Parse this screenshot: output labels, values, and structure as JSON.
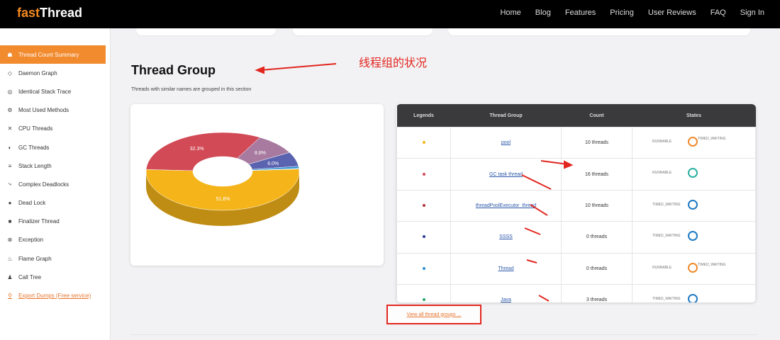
{
  "app": {
    "logo_prefix": "fast",
    "logo_suffix": "Thread"
  },
  "nav": [
    "Home",
    "Blog",
    "Features",
    "Pricing",
    "User Reviews",
    "FAQ",
    "Sign In"
  ],
  "sidebar": {
    "items": [
      {
        "label": "Thread Count Summary",
        "icon": "summary-icon",
        "glyph": "☗"
      },
      {
        "label": "Daemon Graph",
        "icon": "daemon-icon",
        "glyph": "◇"
      },
      {
        "label": "Identical Stack Trace",
        "icon": "stack-icon",
        "glyph": "◎"
      },
      {
        "label": "Most Used Methods",
        "icon": "methods-icon",
        "glyph": "⚙"
      },
      {
        "label": "CPU Threads",
        "icon": "cpu-icon",
        "glyph": "✕"
      },
      {
        "label": "GC Threads",
        "icon": "gc-icon",
        "glyph": "◐"
      },
      {
        "label": "Stack Length",
        "icon": "length-icon",
        "glyph": "≡"
      },
      {
        "label": "Complex Deadlocks",
        "icon": "deadlock-icon",
        "glyph": "⤷"
      },
      {
        "label": "Dead Lock",
        "icon": "lock-icon",
        "glyph": "●"
      },
      {
        "label": "Finalizer Thread",
        "icon": "finalizer-icon",
        "glyph": "■"
      },
      {
        "label": "Exception",
        "icon": "exception-icon",
        "glyph": "⊗"
      },
      {
        "label": "Flame Graph",
        "icon": "flame-icon",
        "glyph": "♨"
      },
      {
        "label": "Call Tree",
        "icon": "tree-icon",
        "glyph": "♟"
      },
      {
        "label": "Export Dumps (Free service)",
        "icon": "export-icon",
        "glyph": "⚲"
      }
    ]
  },
  "main": {
    "title": "Thread Group",
    "description": "Threads with similar names are grouped in this section",
    "annotation": "线程组的状况",
    "more_button": "View all thread groups ..."
  },
  "chart_data": {
    "type": "pie",
    "title": "",
    "categories": [
      "GC task thread",
      "pool",
      "threadPoolExecutor",
      "Thread",
      "SSSS",
      "Java"
    ],
    "values": [
      51.8,
      32.3,
      8.8,
      6.0,
      0.9,
      0.2
    ],
    "labels": [
      "51.8%",
      "32.3%",
      "8.8%",
      "6.0%",
      "",
      ""
    ],
    "colors": [
      "#f5b51a",
      "#d14a56",
      "#a87aa0",
      "#5a63b0",
      "#2d8fd0",
      "#6fc9c6"
    ]
  },
  "table": {
    "headers": [
      "Legends",
      "Thread Group",
      "Count",
      "States"
    ],
    "rows": [
      {
        "color": "#f5b51a",
        "group": "pool",
        "count": "10 threads",
        "state_left": "RUNNABLE",
        "state_right": "TIMED_WAITING",
        "ring": "#ee8a2c"
      },
      {
        "color": "#d14a56",
        "group": "GC task thread",
        "count": "16 threads",
        "state_left": "RUNNABLE",
        "state_right": "",
        "ring": "#2ab0a0"
      },
      {
        "color": "#b0303a",
        "group": "threadPoolExecutor_thread",
        "count": "10 threads",
        "state_left": "TIMED_WAITING",
        "state_right": "",
        "ring": "#1f7bc4"
      },
      {
        "color": "#2a3f9a",
        "group": "SSSS",
        "count": "0 threads",
        "state_left": "TIMED_WAITING",
        "state_right": "",
        "ring": "#1f7bc4"
      },
      {
        "color": "#2d8fd0",
        "group": "Thread",
        "count": "0 threads",
        "state_left": "RUNNABLE",
        "state_right": "TIMED_WAITING",
        "ring": "#ee8a2c"
      },
      {
        "color": "#2aa56b",
        "group": "Java",
        "count": "3 threads",
        "state_left": "TIMED_WAITING",
        "state_right": "",
        "ring": "#1f7bc4"
      }
    ]
  }
}
